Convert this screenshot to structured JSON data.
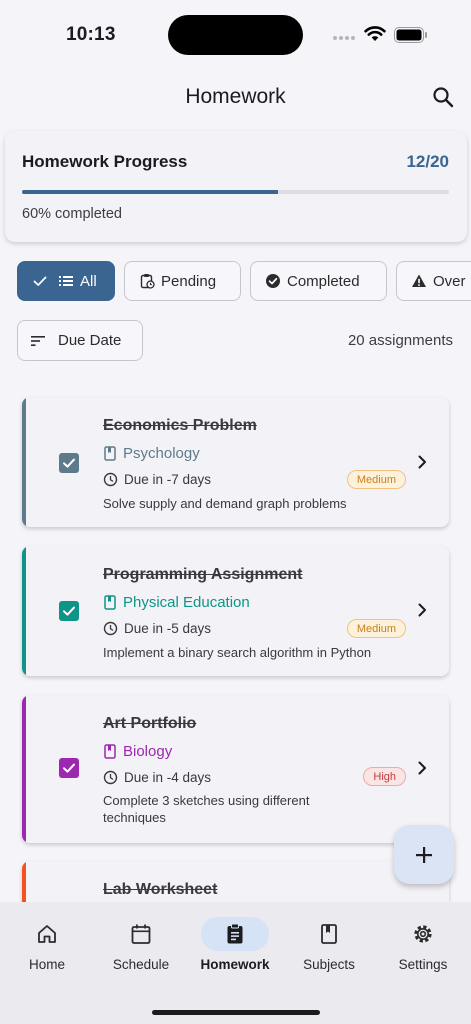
{
  "status_bar": {
    "time": "10:13"
  },
  "header": {
    "title": "Homework"
  },
  "progress": {
    "title": "Homework Progress",
    "count": "12/20",
    "fraction": 0.6,
    "completed_text": "60% completed"
  },
  "filters": [
    {
      "label": "All",
      "icon": "list-icon",
      "selected": true
    },
    {
      "label": "Pending",
      "icon": "pending-clipboard-icon",
      "selected": false
    },
    {
      "label": "Completed",
      "icon": "check-circle-icon",
      "selected": false
    },
    {
      "label": "Over",
      "icon": "warning-icon",
      "selected": false
    }
  ],
  "sort": {
    "label": "Due Date",
    "icon": "sort-icon"
  },
  "assignment_count": "20 assignments",
  "assignments": [
    {
      "title": "Economics Problem",
      "subject": "Psychology",
      "subject_color": "#5d7b8a",
      "due": "Due in -7 days",
      "priority": "Medium",
      "description": "Solve supply and demand graph problems",
      "checked": true
    },
    {
      "title": "Programming Assignment",
      "subject": "Physical Education",
      "subject_color": "#0f9488",
      "due": "Due in -5 days",
      "priority": "Medium",
      "description": "Implement a binary search algorithm in Python",
      "checked": true
    },
    {
      "title": "Art Portfolio",
      "subject": "Biology",
      "subject_color": "#9c27b0",
      "due": "Due in -4 days",
      "priority": "High",
      "description": "Complete 3 sketches using different techniques",
      "checked": true
    },
    {
      "title": "Lab Worksheet",
      "subject_color": "#f4511e"
    }
  ],
  "nav": [
    {
      "label": "Home",
      "icon": "home-icon",
      "active": false
    },
    {
      "label": "Schedule",
      "icon": "calendar-icon",
      "active": false
    },
    {
      "label": "Homework",
      "icon": "clipboard-icon",
      "active": true
    },
    {
      "label": "Subjects",
      "icon": "book-icon",
      "active": false
    },
    {
      "label": "Settings",
      "icon": "gear-icon",
      "active": false
    }
  ],
  "colors": {
    "accent": "#3b6591",
    "fab_bg": "#dbe4f5",
    "nav_active_bg": "#d6e2f6"
  }
}
